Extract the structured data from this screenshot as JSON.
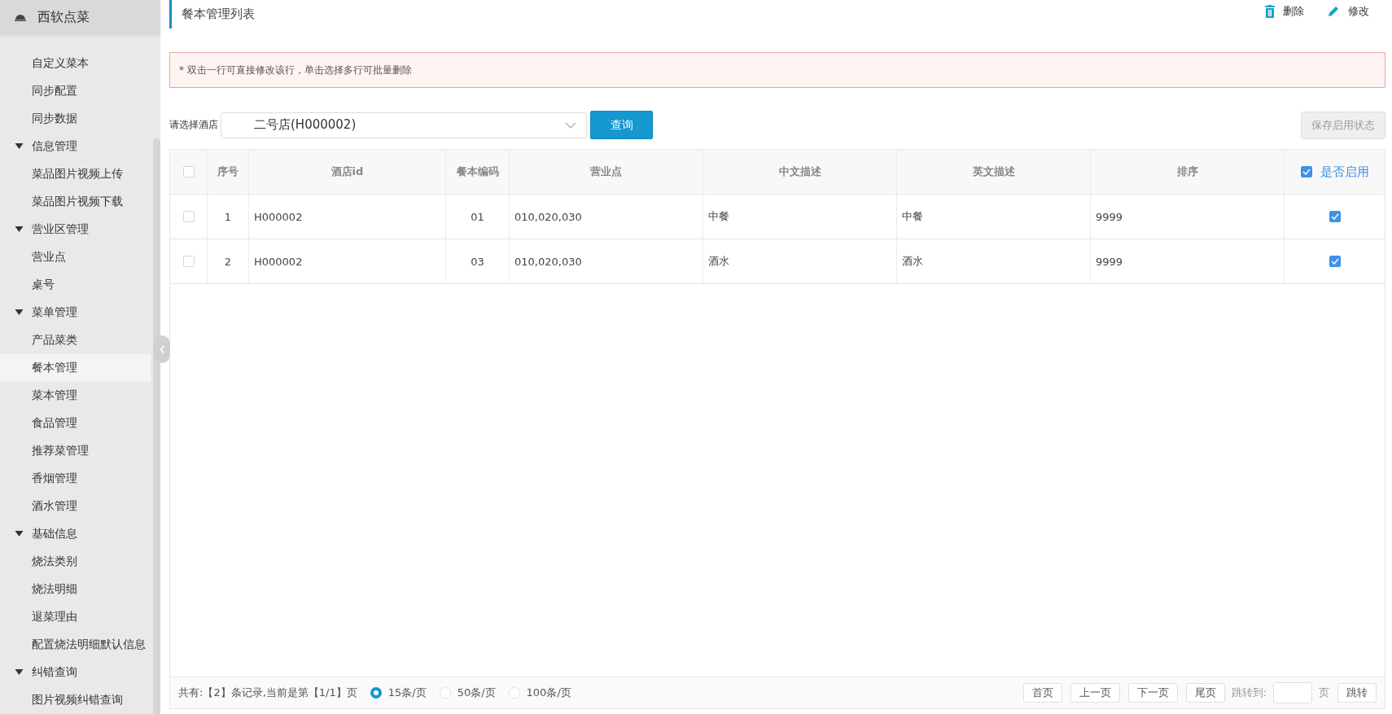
{
  "sidebar": {
    "title": "西软点菜",
    "items": [
      {
        "children": [
          {
            "label": "自定义菜本",
            "selected": false
          },
          {
            "label": "同步配置",
            "selected": false
          },
          {
            "label": "同步数据",
            "selected": false
          }
        ]
      },
      {
        "label": "信息管理",
        "expanded": true,
        "children": [
          {
            "label": "菜品图片视频上传",
            "selected": false
          },
          {
            "label": "菜品图片视频下载",
            "selected": false
          }
        ]
      },
      {
        "label": "营业区管理",
        "expanded": true,
        "children": [
          {
            "label": "营业点",
            "selected": false
          },
          {
            "label": "桌号",
            "selected": false
          }
        ]
      },
      {
        "label": "菜单管理",
        "expanded": true,
        "children": [
          {
            "label": "产品菜类",
            "selected": false
          },
          {
            "label": "餐本管理",
            "selected": true
          },
          {
            "label": "菜本管理",
            "selected": false
          },
          {
            "label": "食品管理",
            "selected": false
          },
          {
            "label": "推荐菜管理",
            "selected": false
          },
          {
            "label": "香烟管理",
            "selected": false
          },
          {
            "label": "酒水管理",
            "selected": false
          }
        ]
      },
      {
        "label": "基础信息",
        "expanded": true,
        "children": [
          {
            "label": "烧法类别",
            "selected": false
          },
          {
            "label": "烧法明细",
            "selected": false
          },
          {
            "label": "退菜理由",
            "selected": false
          },
          {
            "label": "配置烧法明细默认信息",
            "selected": false
          }
        ]
      },
      {
        "label": "纠错查询",
        "expanded": true,
        "children": [
          {
            "label": "图片视频纠错查询",
            "selected": false
          }
        ]
      }
    ]
  },
  "page_title": "餐本管理列表",
  "toolbar": [
    {
      "kind": "delete",
      "label": "删除"
    },
    {
      "kind": "edit",
      "label": "修改"
    }
  ],
  "notice": "* 双击一行可直接修改该行，单击选择多行可批量删除",
  "filter": {
    "label": "请选择酒店",
    "value": "二号店(H000002)",
    "query_button": "查询",
    "save_button": "保存启用状态",
    "save_disabled": true
  },
  "table": {
    "select_all_checked": false,
    "columns": [
      "序号",
      "酒店id",
      "餐本编码",
      "营业点",
      "中文描述",
      "英文描述",
      "排序",
      "是否启用"
    ],
    "enable_all_checked": true,
    "rows": [
      {
        "checked": false,
        "cells": [
          "1",
          "H000002",
          "01",
          "010,020,030",
          "中餐",
          "中餐",
          "9999"
        ],
        "enabled": true
      },
      {
        "checked": false,
        "cells": [
          "2",
          "H000002",
          "03",
          "010,020,030",
          "酒水",
          "酒水",
          "9999"
        ],
        "enabled": true
      }
    ]
  },
  "pager": {
    "summary": "共有:【2】条记录,当前是第【1/1】页",
    "sizes": [
      {
        "label": "15条/页",
        "selected": true
      },
      {
        "label": "50条/页",
        "selected": false
      },
      {
        "label": "100条/页",
        "selected": false
      }
    ],
    "buttons": [
      "首页",
      "上一页",
      "下一页",
      "尾页"
    ],
    "jump_label": "跳转到:",
    "page_unit": "页",
    "jump_button": "跳转"
  }
}
